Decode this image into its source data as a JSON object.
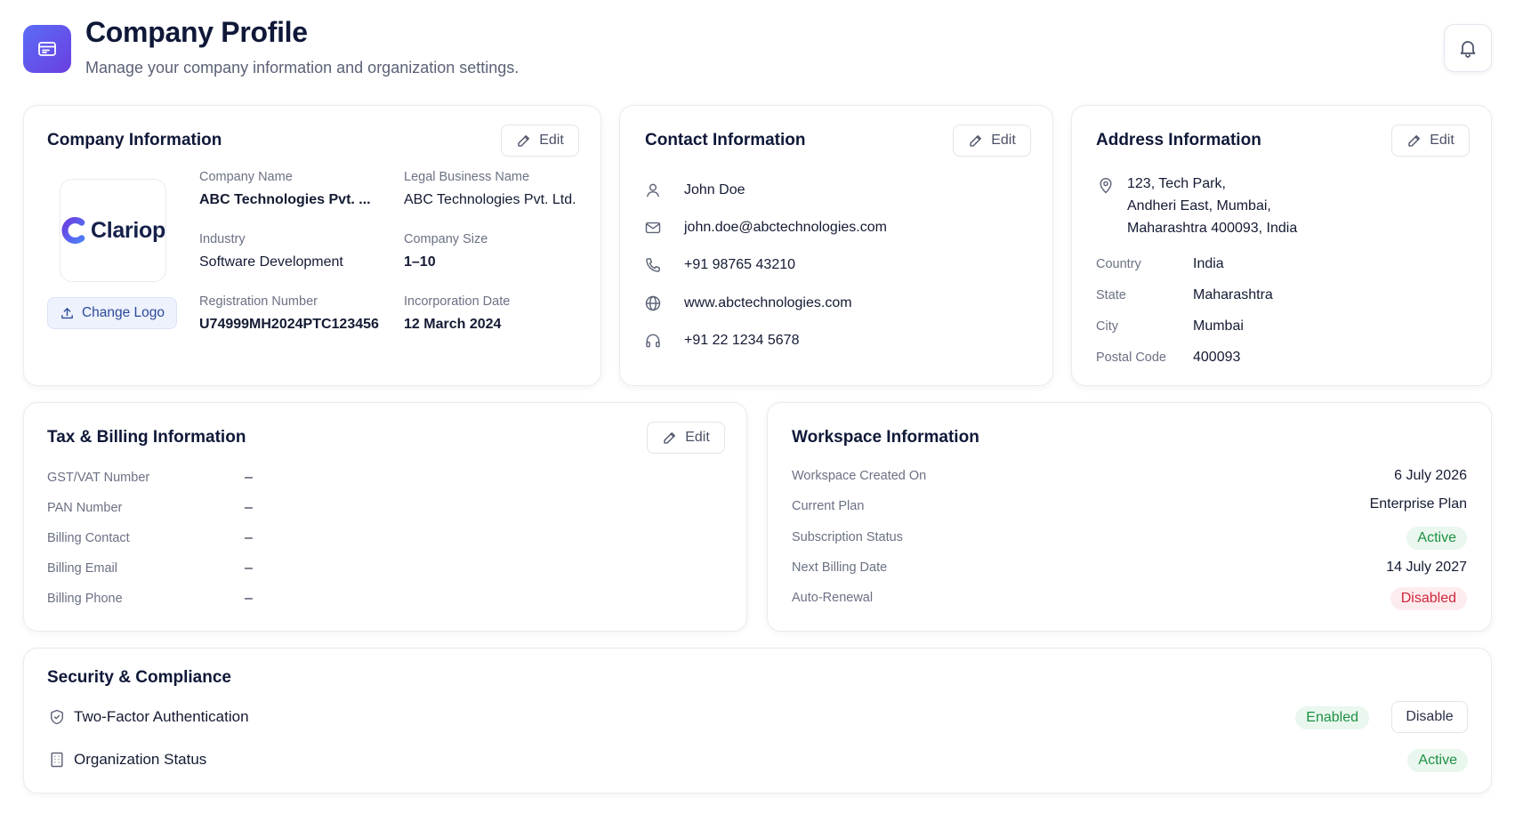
{
  "header": {
    "title": "Company Profile",
    "subtitle": "Manage your company information and organization settings."
  },
  "icons": {
    "app": "browser-window-icon",
    "bell": "bell-icon",
    "edit": "pencil-icon",
    "upload": "upload-icon",
    "user": "user-icon",
    "mail": "mail-icon",
    "phone": "phone-icon",
    "globe": "globe-icon",
    "headset": "headset-icon",
    "pin": "map-pin-icon",
    "shield": "shield-icon",
    "building": "building-icon"
  },
  "colors": {
    "accent": "#5b6cf6",
    "success": "#1e8f43",
    "danger": "#d0263b"
  },
  "company": {
    "title": "Company Information",
    "edit_label": "Edit",
    "logo_text": "Clariop",
    "change_logo_label": "Change Logo",
    "fields": {
      "company_name_label": "Company Name",
      "company_name": "ABC Technologies Pvt. ...",
      "legal_name_label": "Legal Business Name",
      "legal_name": "ABC Technologies Pvt. Ltd.",
      "industry_label": "Industry",
      "industry": "Software Development",
      "size_label": "Company Size",
      "size": "1–10",
      "reg_label": "Registration Number",
      "reg": "U74999MH2024PTC123456",
      "inc_label": "Incorporation Date",
      "inc": "12 March 2024"
    }
  },
  "contact": {
    "title": "Contact Information",
    "edit_label": "Edit",
    "name": "John Doe",
    "email": "john.doe@abctechnologies.com",
    "phone": "+91 98765 43210",
    "website": "www.abctechnologies.com",
    "support": "+91 22 1234 5678"
  },
  "address": {
    "title": "Address Information",
    "edit_label": "Edit",
    "line1": "123, Tech Park,",
    "line2": "Andheri East, Mumbai,",
    "line3": "Maharashtra 400093, India",
    "country_label": "Country",
    "country": "India",
    "state_label": "State",
    "state": "Maharashtra",
    "city_label": "City",
    "city": "Mumbai",
    "postal_label": "Postal Code",
    "postal": "400093"
  },
  "tax": {
    "title": "Tax & Billing Information",
    "edit_label": "Edit",
    "rows": [
      {
        "label": "GST/VAT Number",
        "value": "–"
      },
      {
        "label": "PAN Number",
        "value": "–"
      },
      {
        "label": "Billing Contact",
        "value": "–"
      },
      {
        "label": "Billing Email",
        "value": "–"
      },
      {
        "label": "Billing Phone",
        "value": "–"
      }
    ]
  },
  "workspace": {
    "title": "Workspace Information",
    "created_label": "Workspace Created On",
    "created": "6 July 2026",
    "plan_label": "Current Plan",
    "plan": "Enterprise Plan",
    "status_label": "Subscription Status",
    "status": "Active",
    "next_label": "Next Billing Date",
    "next": "14 July 2027",
    "renewal_label": "Auto-Renewal",
    "renewal": "Disabled"
  },
  "security": {
    "title": "Security & Compliance",
    "tfa_label": "Two-Factor Authentication",
    "tfa_status": "Enabled",
    "tfa_action": "Disable",
    "org_label": "Organization Status",
    "org_status": "Active"
  }
}
